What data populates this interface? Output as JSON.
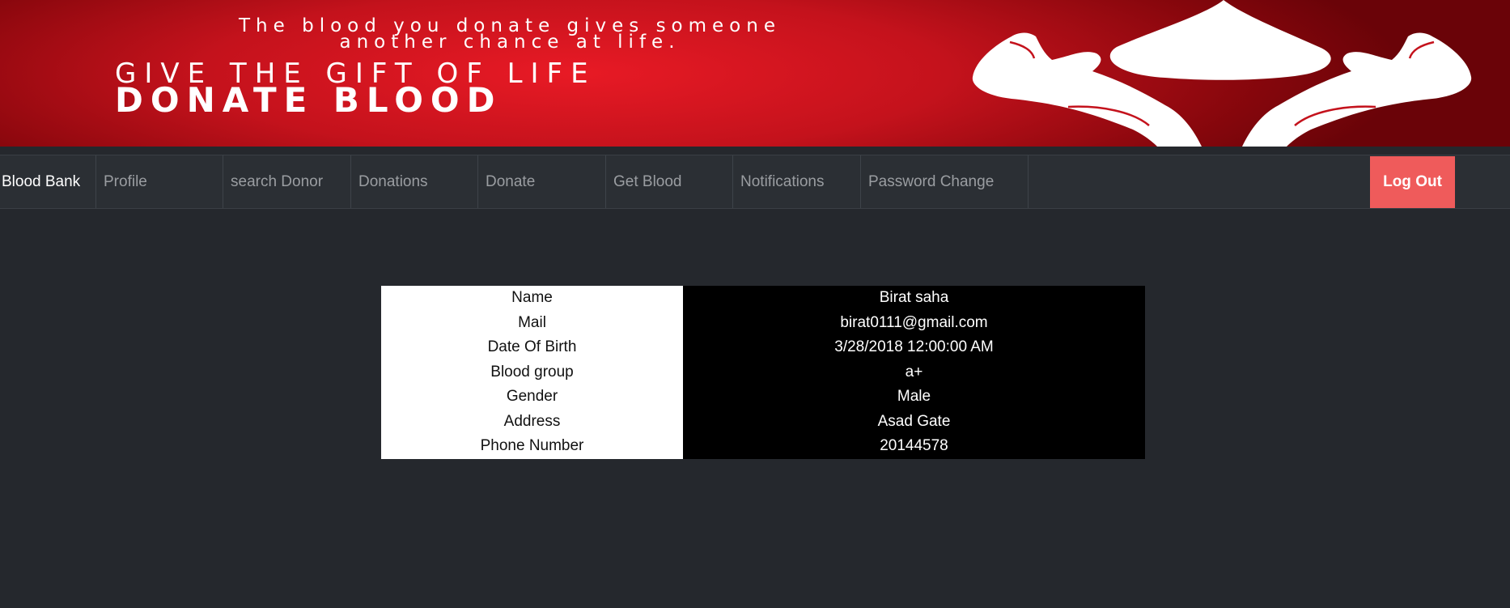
{
  "banner": {
    "tagline_line1": "The blood you donate gives someone",
    "tagline_line2": "another chance at life.",
    "headline": "GIVE THE GIFT OF LIFE",
    "headline2": "DONATE BLOOD"
  },
  "navbar": {
    "brand": "Blood Bank",
    "items": [
      {
        "label": "Profile"
      },
      {
        "label": "search Donor"
      },
      {
        "label": "Donations"
      },
      {
        "label": "Donate"
      },
      {
        "label": "Get Blood"
      },
      {
        "label": "Notifications"
      },
      {
        "label": "Password Change"
      }
    ],
    "logout_label": "Log Out"
  },
  "profile": {
    "rows": [
      {
        "label": "Name",
        "value": "Birat saha"
      },
      {
        "label": "Mail",
        "value": "birat0111@gmail.com"
      },
      {
        "label": "Date Of Birth",
        "value": "3/28/2018 12:00:00 AM"
      },
      {
        "label": "Blood group",
        "value": "a+"
      },
      {
        "label": "Gender",
        "value": "Male"
      },
      {
        "label": "Address",
        "value": "Asad Gate"
      },
      {
        "label": "Phone Number",
        "value": "20144578"
      }
    ]
  },
  "colors": {
    "page_background": "#25282d",
    "navbar_background": "#2b2f34",
    "banner_red": "#d4141f",
    "logout_button": "#ef5b5b",
    "label_cell": "#ffffff",
    "value_cell": "#000000"
  },
  "icons": [
    "blood-drop-icon",
    "hands-icon"
  ]
}
